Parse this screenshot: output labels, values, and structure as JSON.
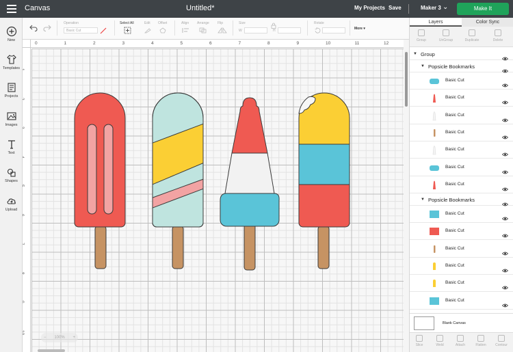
{
  "header": {
    "app_title": "Canvas",
    "doc_title": "Untitled*",
    "my_projects": "My Projects",
    "save": "Save",
    "machine": "Maker 3",
    "make_it": "Make It"
  },
  "left_tools": [
    {
      "label": "New",
      "icon": "plus-circle-icon"
    },
    {
      "label": "Templates",
      "icon": "shirt-icon"
    },
    {
      "label": "Projects",
      "icon": "projects-icon"
    },
    {
      "label": "Images",
      "icon": "image-icon"
    },
    {
      "label": "Text",
      "icon": "text-icon"
    },
    {
      "label": "Shapes",
      "icon": "shapes-icon"
    },
    {
      "label": "Upload",
      "icon": "cloud-upload-icon"
    }
  ],
  "toolbar": {
    "operation_label": "Operation",
    "operation_value": "Basic Cut",
    "select_all": "Select All",
    "edit": "Edit",
    "offset": "Offset",
    "align": "Align",
    "arrange": "Arrange",
    "flip": "Flip",
    "size": "Size",
    "size_w": "W",
    "size_h": "H",
    "rotate": "Rotate",
    "more": "More"
  },
  "ruler": {
    "top": [
      "0",
      "1",
      "2",
      "3",
      "4",
      "5",
      "6",
      "7",
      "8",
      "9",
      "10",
      "11",
      "12"
    ],
    "left": [
      "1",
      "2",
      "3",
      "4",
      "5",
      "6",
      "7",
      "8",
      "9",
      "10"
    ]
  },
  "zoom": "100%",
  "colors": {
    "red": "#ef5a52",
    "pink": "#f2a3a3",
    "mint": "#bfe4df",
    "yellow": "#fbcf34",
    "blue": "#5ac4d8",
    "white": "#f2f2f2",
    "stick": "#c69363",
    "outline": "#3a3a3a",
    "green": "#1fa35a"
  },
  "panel": {
    "tabs": [
      "Layers",
      "Color Sync"
    ],
    "actions": [
      "Group",
      "UnGroup",
      "Duplicate",
      "Delete"
    ],
    "group_label": "Group",
    "groups": [
      {
        "label": "Popsicle Bookmarks",
        "layers": [
          {
            "label": "Basic Cut",
            "thumb": "blue-rounded"
          },
          {
            "label": "Basic Cut",
            "thumb": "red-rocket"
          },
          {
            "label": "Basic Cut",
            "thumb": "white-rocket"
          },
          {
            "label": "Basic Cut",
            "thumb": "stick"
          },
          {
            "label": "Basic Cut",
            "thumb": "white-rocket"
          },
          {
            "label": "Basic Cut",
            "thumb": "blue-rounded"
          },
          {
            "label": "Basic Cut",
            "thumb": "red-rocket"
          }
        ]
      },
      {
        "label": "Popsicle Bookmarks",
        "layers": [
          {
            "label": "Basic Cut",
            "thumb": "blue-square"
          },
          {
            "label": "Basic Cut",
            "thumb": "red-square"
          },
          {
            "label": "Basic Cut",
            "thumb": "stick"
          },
          {
            "label": "Basic Cut",
            "thumb": "yellow-pop"
          },
          {
            "label": "Basic Cut",
            "thumb": "yellow-pop"
          },
          {
            "label": "Basic Cut",
            "thumb": "blue-square"
          }
        ]
      }
    ],
    "blank_canvas": "Blank Canvas",
    "bottom_actions": [
      "Slice",
      "Weld",
      "Attach",
      "Flatten",
      "Contour"
    ]
  }
}
